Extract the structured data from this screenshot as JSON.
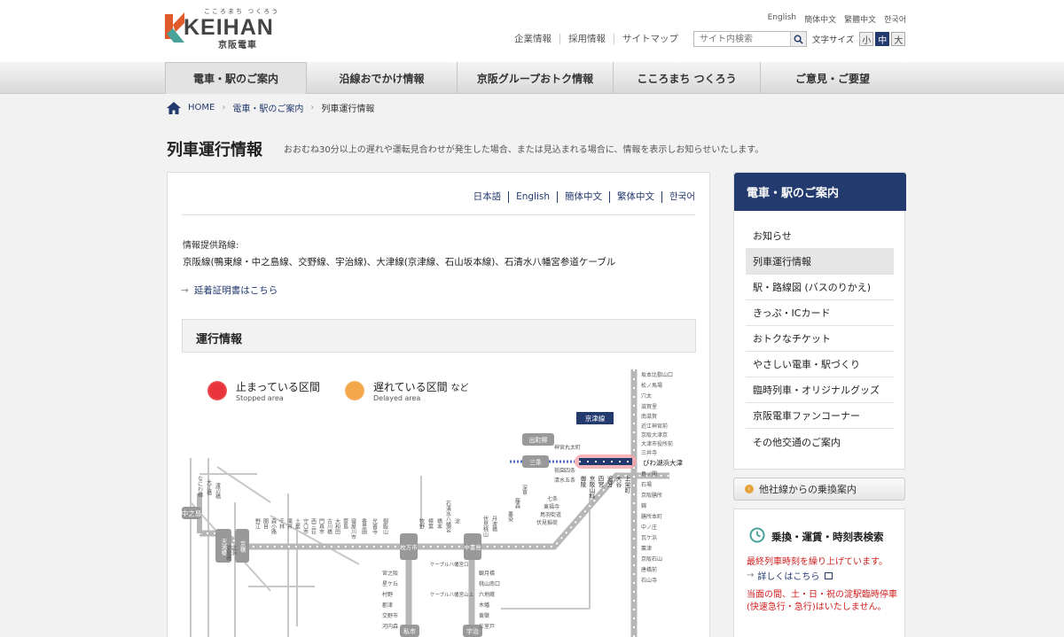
{
  "header": {
    "logo_tagline": "こころまち つくろう",
    "logo_word": "KEIHAN",
    "logo_jp": "京阪電車",
    "languages": [
      "English",
      "簡体中文",
      "繁體中文",
      "한국어"
    ],
    "util_links": [
      "企業情報",
      "採用情報",
      "サイトマップ"
    ],
    "search_placeholder": "サイト内検索",
    "fontsize_label": "文字サイズ",
    "fontsizes": [
      "小",
      "中",
      "大"
    ]
  },
  "gnav": [
    "電車・駅のご案内",
    "沿線おでかけ情報",
    "京阪グループおトク情報",
    "こころまち つくろう",
    "ご意見・ご要望"
  ],
  "breadcrumb": {
    "home": "HOME",
    "parent": "電車・駅のご案内",
    "current": "列車運行情報"
  },
  "page": {
    "title": "列車運行情報",
    "description": "おおむね30分以上の遅れや運転見合わせが発生した場合、または見込まれる場合に、情報を表示しお知らせいたします。"
  },
  "panel": {
    "lang_tabs": [
      "日本語",
      "English",
      "簡体中文",
      "繁体中文",
      "한국어"
    ],
    "info_label": "情報提供路線:",
    "info_lines": "京阪線(鴨東線・中之島線、交野線、宇治線)、大津線(京津線、石山坂本線)、石清水八幡宮参道ケーブル",
    "cert_link": "延着証明書はこちら",
    "status_title": "運行情報",
    "legend": {
      "stopped": "止まっている区間",
      "stopped_en": "Stopped area",
      "delayed": "遅れている区間",
      "delayed_en": "Delayed area",
      "delayed_extra": "など"
    },
    "colors": {
      "stopped": "#e8343a",
      "delayed": "#f3a64a",
      "brand": "#233a6e"
    }
  },
  "map": {
    "label_keishin": "京津線",
    "nakanoshima": "中之島",
    "temmabashi": "天満橋",
    "kyobashi": "京橋",
    "yodoyabashi": "淀屋橋",
    "kitahama": "北浜",
    "hirakatashi": "枚方市",
    "chushojima": "中書島",
    "sanjo": "三条",
    "demachiyanagi": "出町柳",
    "biwako": "びわ湖浜大津",
    "kisaichi": "私市",
    "uji": "宇治",
    "cable_top": "ケーブル八幡宮口",
    "cable_bottom": "ケーブル八幡宮山上",
    "ishiyama_stations": [
      "坂本比叡山口",
      "松ノ馬場",
      "穴太",
      "滋賀里",
      "南滋賀",
      "近江神宮前",
      "京阪大津京",
      "大津市役所前",
      "三井寺"
    ],
    "south_stations": [
      "島ノ関",
      "石場",
      "京阪膳所",
      "錦",
      "膳所本町",
      "中ノ庄",
      "瓦ケ浜",
      "粟津",
      "京阪石山",
      "唐橋前",
      "石山寺"
    ],
    "keishin_stations": [
      "御陵",
      "京阪山科",
      "四宮",
      "追分",
      "大谷",
      "上栄町"
    ],
    "katano_stations": [
      "宮之阪",
      "星ケ丘",
      "村野",
      "郡津",
      "交野市",
      "河内森"
    ],
    "uji_stations": [
      "観月橋",
      "桃山南口",
      "六地蔵",
      "木幡",
      "黄檗",
      "三室戸"
    ],
    "north_stations": [
      "神宮丸太町",
      "祇園四条",
      "清水五条",
      "七条",
      "東福寺",
      "鳥羽街道",
      "伏見稲荷"
    ],
    "main_west": [
      "野江",
      "関目",
      "森小路",
      "千林",
      "滝井",
      "土居",
      "守口市",
      "西三荘",
      "門真市",
      "古川橋",
      "大和田",
      "萱島",
      "寝屋川市",
      "香里園",
      "光善寺",
      "御殿山"
    ],
    "main_mid": [
      "牧野",
      "樟葉",
      "橋本",
      "石清水八幡宮",
      "淀"
    ],
    "main_east": [
      "伏見桃山",
      "丹波橋",
      "墨染",
      "藤森",
      "深草"
    ],
    "nakanoshima_stations": [
      "なにわ橋",
      "大江橋",
      "渡辺橋"
    ]
  },
  "side_nav": {
    "title": "電車・駅のご案内",
    "items": [
      "お知らせ",
      "列車運行情報",
      "駅・路線図 (バスのりかえ)",
      "きっぷ・ICカード",
      "おトクなチケット",
      "やさしい電車・駅づくり",
      "臨時列車・オリジナルグッズ",
      "京阪電車ファンコーナー",
      "その他交通のご案内"
    ]
  },
  "transfer": {
    "label": "他社線からの乗換案内"
  },
  "timetable": {
    "title": "乗換・運賃・時刻表検索",
    "notice": "最終列車時刻を繰り上げています。",
    "link": "詳しくはこちら",
    "extra": "当面の間、土・日・祝の淀駅臨時停車(快速急行・急行)はいたしません。"
  }
}
